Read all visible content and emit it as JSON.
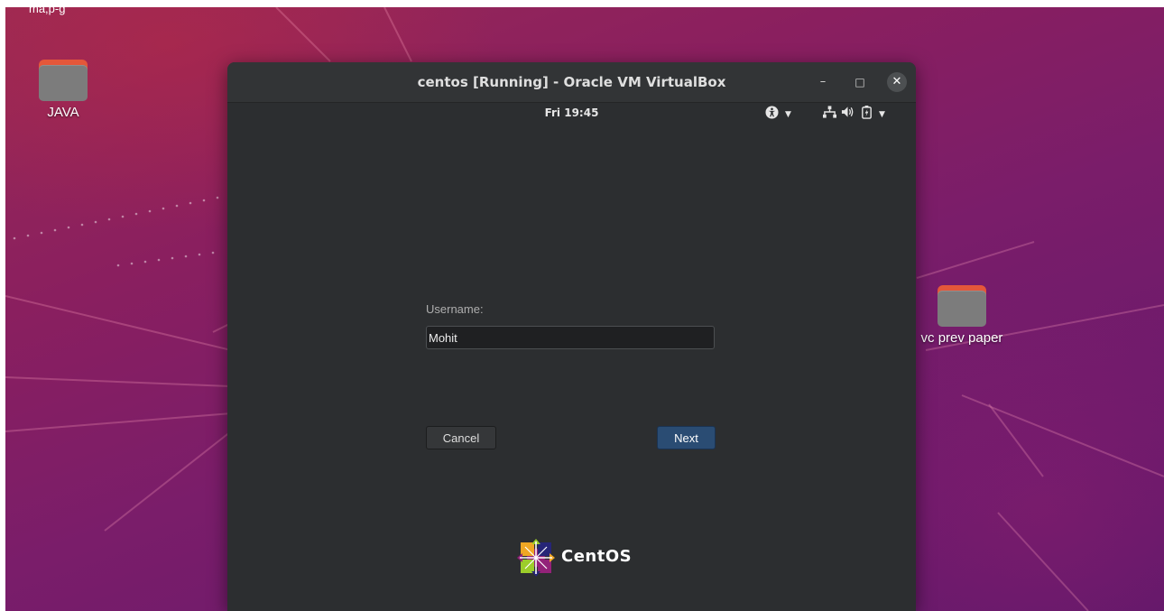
{
  "desktop": {
    "top_fragment": "ma,p-g",
    "icons": [
      {
        "label": "JAVA"
      },
      {
        "label": "vc prev paper"
      }
    ]
  },
  "window": {
    "title": "centos [Running] - Oracle VM VirtualBox",
    "controls": {
      "minimize": "–",
      "maximize": "□",
      "close": "✕"
    }
  },
  "guest": {
    "topbar": {
      "clock": "Fri 19:45",
      "icons": [
        "accessibility-icon",
        "network-icon",
        "volume-icon",
        "battery-icon",
        "menu-arrow-icon"
      ]
    },
    "login": {
      "username_label": "Username:",
      "username_value": "Mohit",
      "cancel_label": "Cancel",
      "next_label": "Next"
    },
    "brand": {
      "name": "CentOS"
    }
  },
  "colors": {
    "wallpaper": "#7a1d6a",
    "window_bg": "#2f3133",
    "next_button": "#2a4c73",
    "folder_tab": "#e4573a"
  }
}
